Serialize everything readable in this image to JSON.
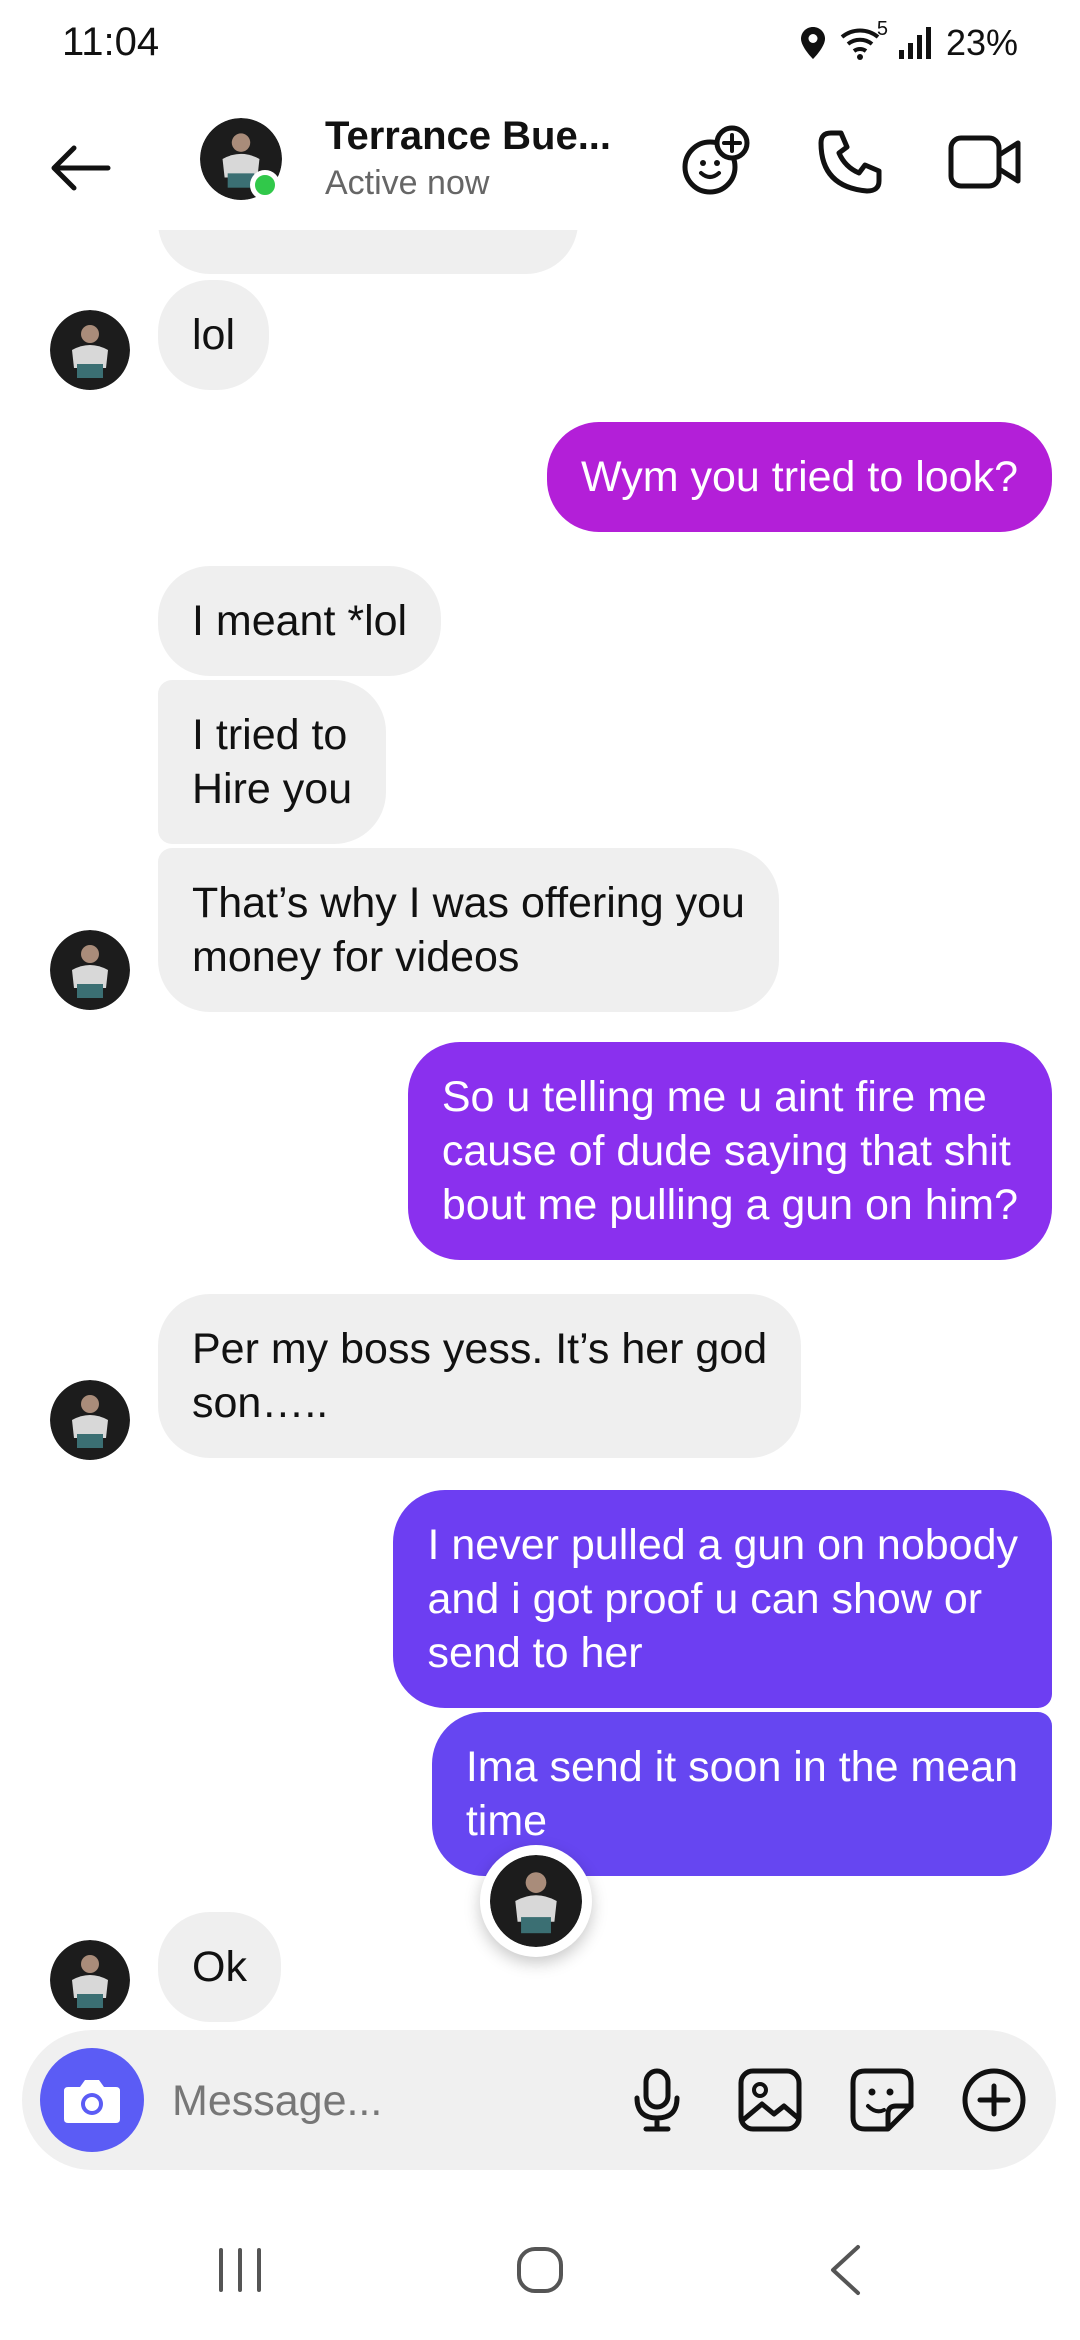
{
  "status_bar": {
    "time": "11:04",
    "wifi_label": "5",
    "battery": "23%"
  },
  "header": {
    "contact_name": "Terrance Bue...",
    "status": "Active now"
  },
  "icons": {
    "back": "back-arrow-icon",
    "game": "game-add-icon",
    "call": "phone-icon",
    "video": "video-camera-icon",
    "camera": "camera-icon",
    "mic": "microphone-icon",
    "gallery": "image-icon",
    "sticker": "sticker-icon",
    "more": "plus-circle-icon"
  },
  "messages": [
    {
      "from": "them",
      "text": "lol"
    },
    {
      "from": "me",
      "text": "Wym you tried to look?"
    },
    {
      "from": "them",
      "text": "I meant *lol"
    },
    {
      "from": "them",
      "text": "I tried to\nHire you"
    },
    {
      "from": "them",
      "text": "That’s why I was offering you\nmoney for videos"
    },
    {
      "from": "me",
      "text": "So u telling me u aint fire me\ncause of dude saying that shit\nbout me pulling a gun on him?"
    },
    {
      "from": "them",
      "text": "Per my boss yess. It’s her god\nson….."
    },
    {
      "from": "me",
      "text": "I never pulled a gun on nobody\nand i got proof u can show or\nsend to her"
    },
    {
      "from": "me",
      "text": "Ima send it soon in the mean\ntime"
    },
    {
      "from": "them",
      "text": "Ok"
    }
  ],
  "composer": {
    "placeholder": "Message..."
  },
  "colors": {
    "incoming_bubble": "#efefef",
    "outgoing_1": "#b31fd8",
    "outgoing_2": "#8a30ee",
    "outgoing_3": "#6d3ef2",
    "outgoing_4": "#6646f1",
    "online": "#31c84a",
    "camera_button": "#5b5cf5"
  }
}
